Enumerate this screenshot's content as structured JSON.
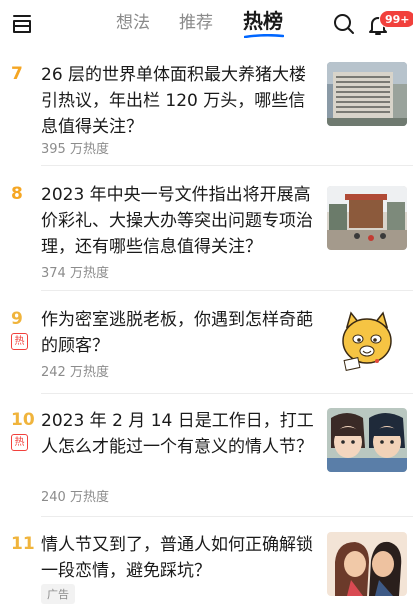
{
  "header": {
    "tabs": [
      {
        "label": "想法"
      },
      {
        "label": "推荐"
      },
      {
        "label": "热榜"
      }
    ],
    "notification_count": "99+",
    "accent": "#0066ff"
  },
  "colors": {
    "rank_top": "#f5a623",
    "rank_normal": "#f0b43c",
    "hot": "#f1403c"
  },
  "items": [
    {
      "rank": "7",
      "title": "26 层的世界单体面积最大养猪大楼引热议，年出栏 120 万头，哪些信息值得关注？",
      "heat": "395 万热度",
      "thumb": "pig-building-photo"
    },
    {
      "rank": "8",
      "title": "2023 年中央一号文件指出将开展高价彩礼、大操大办等突出问题专项治理，还有哪些信息值得关注？",
      "heat": "374 万热度",
      "thumb": "wedding-street-photo"
    },
    {
      "rank": "9",
      "hot_label": "热",
      "title": "作为密室逃脱老板，你遇到怎样奇葩的顾客？",
      "heat": "242 万热度",
      "thumb": "cartoon-cat"
    },
    {
      "rank": "10",
      "hot_label": "热",
      "title": "2023 年 2 月 14 日是工作日，打工人怎么才能过一个有意义的情人节？",
      "heat": "240 万热度",
      "thumb": "anime-couple"
    },
    {
      "rank": "11",
      "title": "情人节又到了，普通人如何正确解锁一段恋情，避免踩坑？",
      "ad_label": "广告",
      "thumb": "couple-illustration"
    }
  ]
}
